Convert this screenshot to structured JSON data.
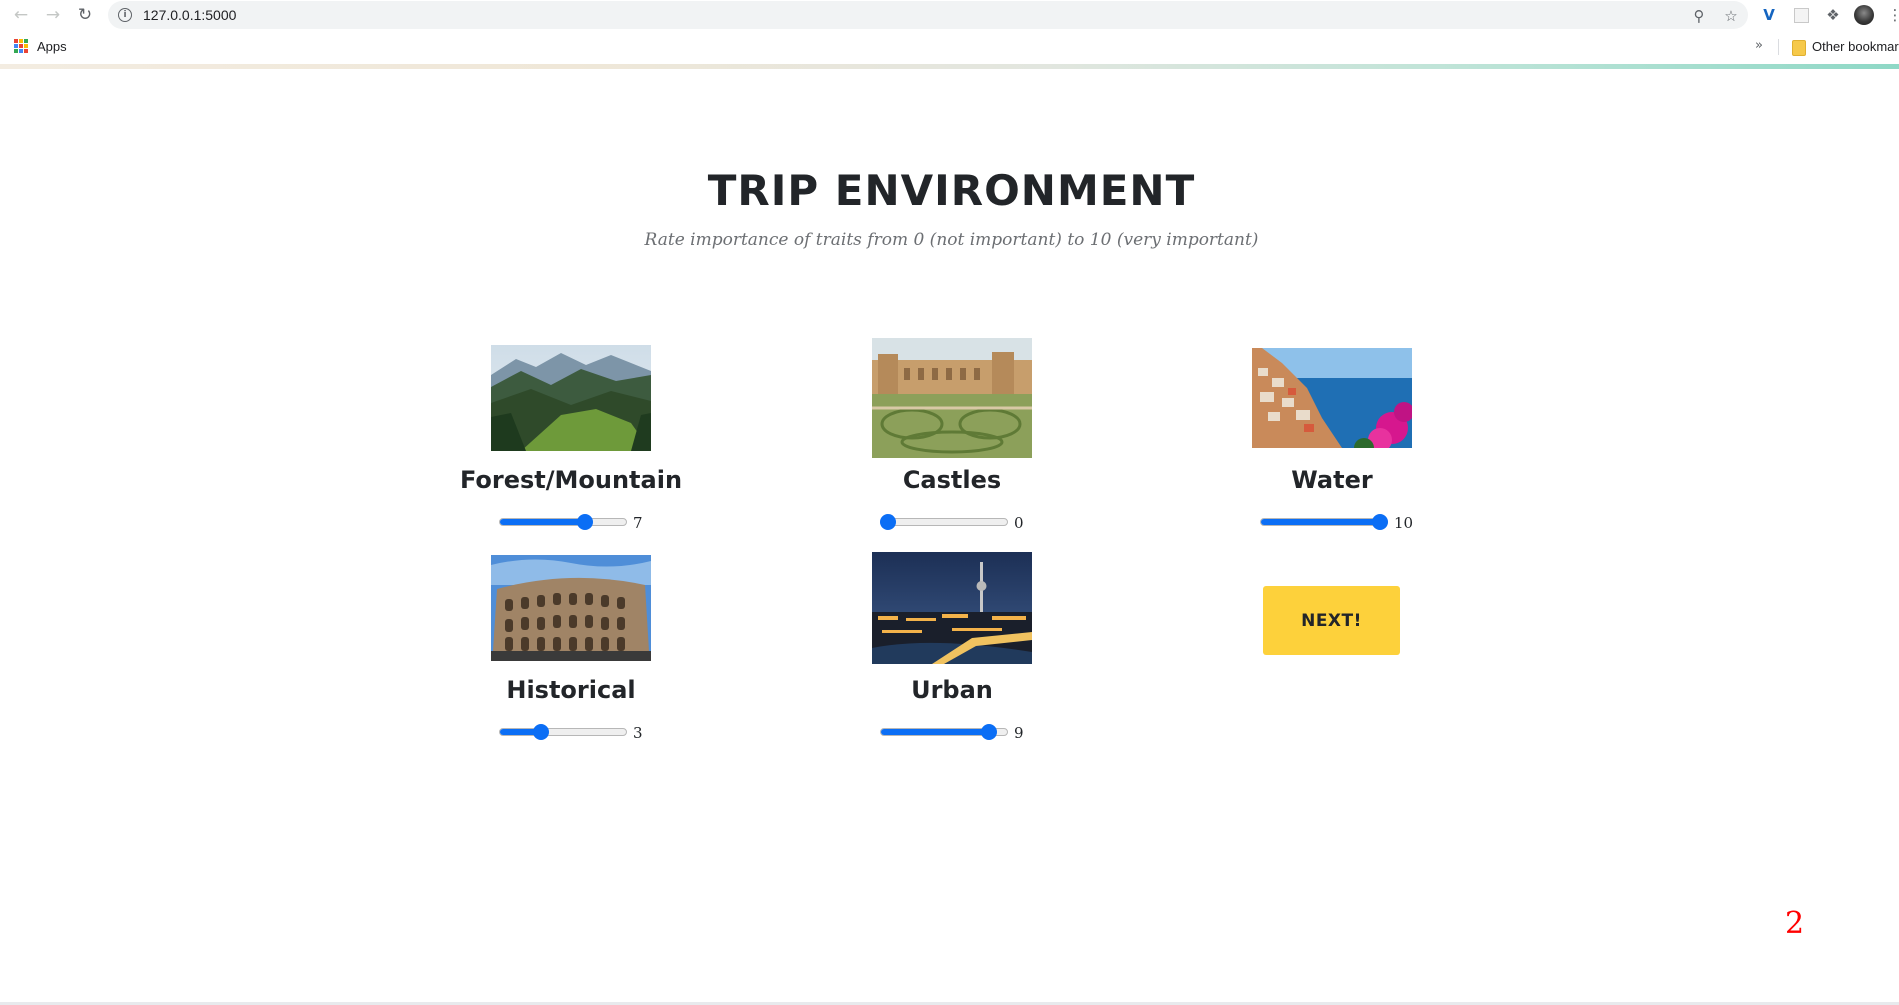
{
  "browser": {
    "url": "127.0.0.1:5000",
    "bookmarks_bar": {
      "apps_label": "Apps",
      "overflow_glyph": "»",
      "other_bookmarks_label": "Other bookmark"
    }
  },
  "page": {
    "title": "TRIP ENVIRONMENT",
    "subtitle": "Rate importance of traits from 0 (not important) to 10 (very important)",
    "traits": [
      {
        "label": "Forest/Mountain",
        "value": "7",
        "level": 7,
        "max": 10,
        "image": "mountain-valley-photo"
      },
      {
        "label": "Castles",
        "value": "0",
        "level": 0,
        "max": 10,
        "image": "palace-gardens-photo"
      },
      {
        "label": "Water",
        "value": "10",
        "level": 10,
        "max": 10,
        "image": "coastal-town-photo"
      },
      {
        "label": "Historical",
        "value": "3",
        "level": 3,
        "max": 10,
        "image": "colosseum-photo"
      },
      {
        "label": "Urban",
        "value": "9",
        "level": 9,
        "max": 10,
        "image": "city-night-skyline-photo"
      }
    ],
    "next_button_label": "NEXT!",
    "page_number": "2"
  },
  "colors": {
    "slider_accent": "#0b6ef5",
    "next_button": "#fdd13b",
    "page_number": "#ff0000"
  }
}
